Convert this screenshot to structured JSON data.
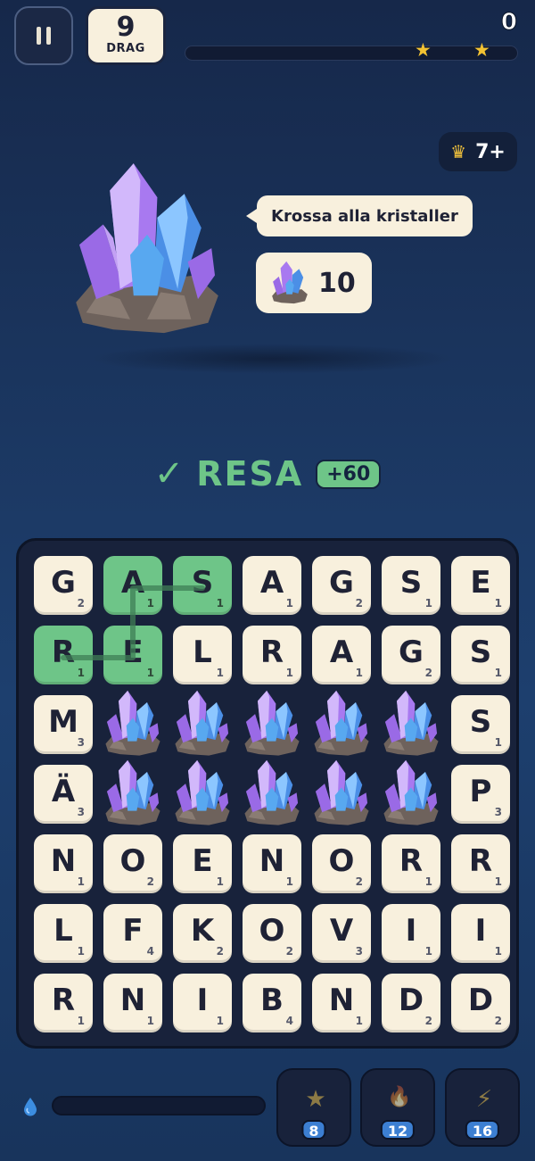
{
  "hud": {
    "moves_count": "9",
    "moves_label": "DRAG",
    "score": "0",
    "star_progress": 0
  },
  "goal": {
    "crown_level": "7+",
    "instruction": "Krossa alla kristaller",
    "crystal_count": "10"
  },
  "last_word": {
    "word": "RESA",
    "points": "+60"
  },
  "colors": {
    "background": "#1c3a66",
    "tile": "#f8f0dd",
    "selected_tile": "#6ec588",
    "star": "#f2c232",
    "badge_blue": "#3c7fd2"
  },
  "board": {
    "rows": [
      [
        {
          "l": "G",
          "p": "2"
        },
        {
          "l": "A",
          "p": "1",
          "sel": true
        },
        {
          "l": "S",
          "p": "1",
          "sel": true
        },
        {
          "l": "A",
          "p": "1"
        },
        {
          "l": "G",
          "p": "2"
        },
        {
          "l": "S",
          "p": "1"
        },
        {
          "l": "E",
          "p": "1"
        }
      ],
      [
        {
          "l": "R",
          "p": "1",
          "sel": true
        },
        {
          "l": "E",
          "p": "1",
          "sel": true
        },
        {
          "l": "L",
          "p": "1"
        },
        {
          "l": "R",
          "p": "1"
        },
        {
          "l": "A",
          "p": "1"
        },
        {
          "l": "G",
          "p": "2"
        },
        {
          "l": "S",
          "p": "1"
        }
      ],
      [
        {
          "l": "M",
          "p": "3"
        },
        {
          "crystal": true
        },
        {
          "crystal": true
        },
        {
          "crystal": true
        },
        {
          "crystal": true
        },
        {
          "crystal": true
        },
        {
          "l": "S",
          "p": "1"
        }
      ],
      [
        {
          "l": "Ä",
          "p": "3"
        },
        {
          "crystal": true
        },
        {
          "crystal": true
        },
        {
          "crystal": true
        },
        {
          "crystal": true
        },
        {
          "crystal": true
        },
        {
          "l": "P",
          "p": "3"
        }
      ],
      [
        {
          "l": "N",
          "p": "1"
        },
        {
          "l": "O",
          "p": "2"
        },
        {
          "l": "E",
          "p": "1"
        },
        {
          "l": "N",
          "p": "1"
        },
        {
          "l": "O",
          "p": "2"
        },
        {
          "l": "R",
          "p": "1"
        },
        {
          "l": "R",
          "p": "1"
        }
      ],
      [
        {
          "l": "L",
          "p": "1"
        },
        {
          "l": "F",
          "p": "4"
        },
        {
          "l": "K",
          "p": "2"
        },
        {
          "l": "O",
          "p": "2"
        },
        {
          "l": "V",
          "p": "3"
        },
        {
          "l": "I",
          "p": "1"
        },
        {
          "l": "I",
          "p": "1"
        }
      ],
      [
        {
          "l": "R",
          "p": "1"
        },
        {
          "l": "N",
          "p": "1"
        },
        {
          "l": "I",
          "p": "1"
        },
        {
          "l": "B",
          "p": "4"
        },
        {
          "l": "N",
          "p": "1"
        },
        {
          "l": "D",
          "p": "2"
        },
        {
          "l": "D",
          "p": "2"
        }
      ]
    ],
    "selected_path": [
      [
        1,
        0
      ],
      [
        1,
        1
      ],
      [
        0,
        1
      ],
      [
        0,
        2
      ]
    ]
  },
  "powerups": [
    {
      "name": "star-powerup-button",
      "icon": "star-icon",
      "glyph": "★",
      "count": "8",
      "color": "#8c7a45"
    },
    {
      "name": "fire-powerup-button",
      "icon": "flame-icon",
      "glyph": "🔥",
      "count": "12",
      "color": "#8a4a3c"
    },
    {
      "name": "lightning-powerup-button",
      "icon": "lightning-icon",
      "glyph": "⚡",
      "count": "16",
      "color": "#8c7a45"
    }
  ],
  "energy_level": 0
}
